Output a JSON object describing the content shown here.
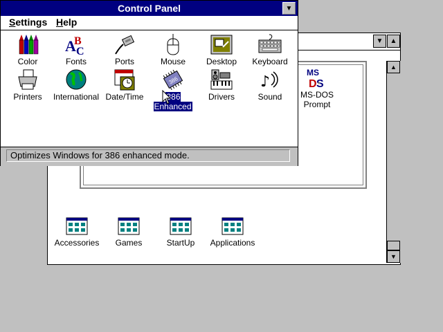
{
  "control_panel": {
    "title": "Control Panel",
    "menu": [
      {
        "label": "Settings",
        "u": "S",
        "rest": "ettings"
      },
      {
        "label": "Help",
        "u": "H",
        "rest": "elp"
      }
    ],
    "icons": [
      {
        "label": "Color",
        "icon": "crayons-icon"
      },
      {
        "label": "Fonts",
        "icon": "fonts-icon"
      },
      {
        "label": "Ports",
        "icon": "ports-icon"
      },
      {
        "label": "Mouse",
        "icon": "mouse-icon"
      },
      {
        "label": "Desktop",
        "icon": "desktop-icon"
      },
      {
        "label": "Keyboard",
        "icon": "keyboard-icon"
      },
      {
        "label": "Printers",
        "icon": "printer-icon"
      },
      {
        "label": "International",
        "icon": "globe-icon"
      },
      {
        "label": "Date/Time",
        "icon": "clock-icon"
      },
      {
        "label": "386 Enhanced",
        "icon": "chip-icon",
        "selected": true
      },
      {
        "label": "Drivers",
        "icon": "drivers-icon"
      },
      {
        "label": "Sound",
        "icon": "sound-icon"
      }
    ],
    "status": "Optimizes Windows for 386 enhanced mode."
  },
  "program_manager": {
    "dos_prompt": {
      "line1": "MS-DOS",
      "line2": "Prompt",
      "icon": "msdos-icon"
    },
    "groups": [
      {
        "label": "Accessories",
        "icon": "group-icon"
      },
      {
        "label": "Games",
        "icon": "group-icon"
      },
      {
        "label": "StartUp",
        "icon": "group-icon"
      },
      {
        "label": "Applications",
        "icon": "group-icon"
      }
    ]
  },
  "colors": {
    "title_bar": "#000080",
    "face": "#c0c0c0",
    "window": "#ffffff"
  }
}
